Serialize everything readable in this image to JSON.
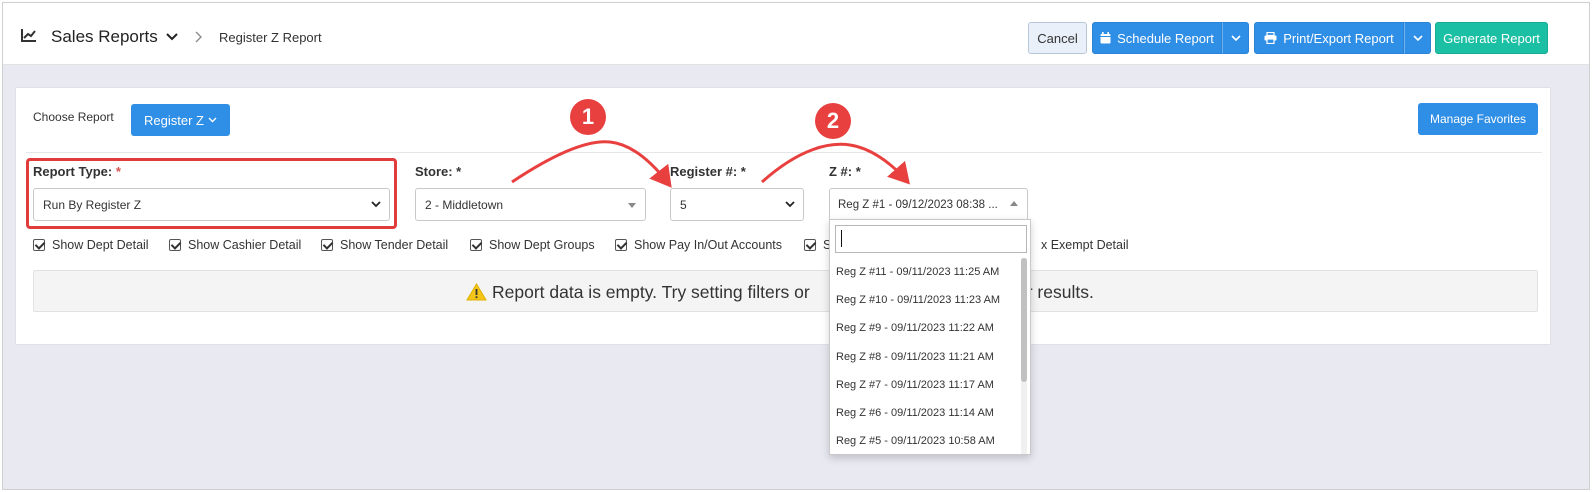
{
  "header": {
    "title": "Sales Reports",
    "current_page": "Register Z Report"
  },
  "toolbar": {
    "cancel_label": "Cancel",
    "schedule_label": "Schedule Report",
    "print_label": "Print/Export Report",
    "generate_label": "Generate Report"
  },
  "chooser": {
    "label": "Choose Report",
    "selected_report": "Register Z",
    "favorites_label": "Manage Favorites"
  },
  "filters": {
    "report_type_label": "Report Type:",
    "report_type_value": "Run By Register Z",
    "store_label": "Store: *",
    "store_value": "2 - Middletown",
    "register_label": "Register #: *",
    "register_value": "5",
    "z_label": "Z #: *",
    "z_value": "Reg Z #1 - 09/12/2023 08:38 ...",
    "required_mark": "*"
  },
  "options": [
    {
      "label": "Show Dept Detail",
      "checked": true
    },
    {
      "label": "Show Cashier Detail",
      "checked": true
    },
    {
      "label": "Show Tender Detail",
      "checked": true
    },
    {
      "label": "Show Dept Groups",
      "checked": true
    },
    {
      "label": "Show Pay In/Out Accounts",
      "checked": true
    },
    {
      "label": "S",
      "checked": true
    },
    {
      "label": "x Exempt Detail",
      "checked": false
    }
  ],
  "empty_message": "Report data is empty. Try setting filters or",
  "empty_message_tail": "r results.",
  "dropdown": {
    "search_value": "",
    "items": [
      "Reg Z #11 - 09/11/2023 11:25 AM",
      "Reg Z #10 - 09/11/2023 11:23 AM",
      "Reg Z #9 - 09/11/2023 11:22 AM",
      "Reg Z #8 - 09/11/2023 11:21 AM",
      "Reg Z #7 - 09/11/2023 11:17 AM",
      "Reg Z #6 - 09/11/2023 11:14 AM",
      "Reg Z #5 - 09/11/2023 10:58 AM"
    ]
  },
  "callouts": {
    "step1": "1",
    "step2": "2",
    "color": "#e8403f"
  },
  "colors": {
    "primary": "#2f8ee5",
    "success": "#1bbfa3",
    "highlight": "#e03c3c"
  }
}
